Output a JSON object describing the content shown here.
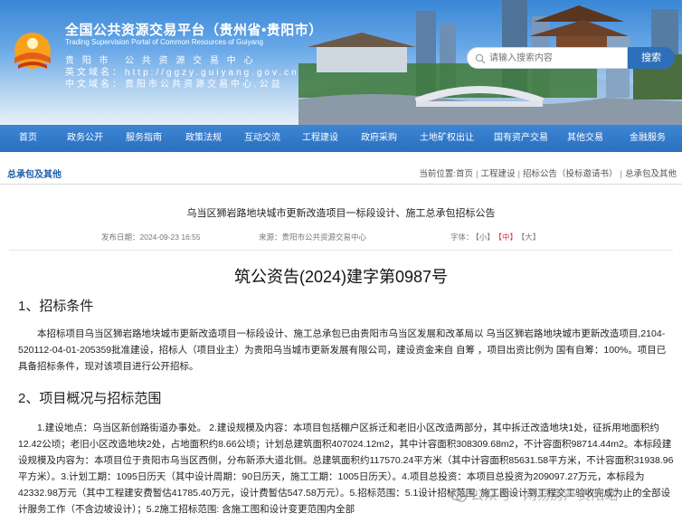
{
  "header": {
    "site_title": "全国公共资源交易平台（贵州省•贵阳市）",
    "site_subtitle": "Trading Supervision Portal of Common Resources of Guiyang",
    "row1_label": "贵 阳 市",
    "row1_value": "公 共 资 源 交 易 中 心",
    "row2_label": "英文域名：",
    "row2_value": "http://ggzy.guiyang.gov.cn",
    "row3_label": "中文域名：",
    "row3_value": "贵阳市公共资源交易中心.公益",
    "search_placeholder": "请输入搜索内容",
    "search_button": "搜索"
  },
  "nav": {
    "items": [
      "首页",
      "政务公开",
      "服务指南",
      "政策法规",
      "互动交流",
      "工程建设",
      "政府采购",
      "土地矿权出让",
      "国有资产交易",
      "其他交易",
      "金融服务"
    ]
  },
  "breadcrumb": {
    "section": "总承包及其他",
    "path": [
      "当前位置:首页",
      "工程建设",
      "招标公告（投标邀请书）",
      "总承包及其他"
    ]
  },
  "article": {
    "title": "乌当区狮岩路地块城市更新改造项目一标段设计、施工总承包招标公告",
    "publish_time": "发布日期：2024-09-23 16:55",
    "source": "来源：贵阳市公共资源交易中心",
    "font_label": "字体：",
    "font_small": "【小】",
    "font_medium": "【中】",
    "font_large": "【大】",
    "doc_number": "筑公资告(2024)建字第0987号",
    "section1_heading": "1、招标条件",
    "section1_text": "本招标项目乌当区狮岩路地块城市更新改造项目一标段设计、施工总承包已由贵阳市乌当区发展和改革局以 乌当区狮岩路地块城市更新改造项目,2104-520112-04-01-205359批准建设，招标人（项目业主）为贵阳乌当城市更新发展有限公司，建设资金来自 自筹 ，项目出资比例为 国有自筹：100%。项目已具备招标条件，现对该项目进行公开招标。",
    "section2_heading": "2、项目概况与招标范围",
    "section2_text": "1.建设地点：乌当区新创路街道办事处。 2.建设规模及内容：本项目包括棚户区拆迁和老旧小区改造两部分，其中拆迁改造地块1处，征拆用地面积约12.42公顷；老旧小区改造地块2处，占地面积约8.66公顷；计划总建筑面积407024.12m2，其中计容面积308309.68m2，不计容面积98714.44m2。本标段建设规模及内容为：本项目位于贵阳市乌当区西侧，分布新添大道北侧。总建筑面积约117570.24平方米（其中计容面积85631.58平方米，不计容面积31938.96平方米）。3.计划工期：1095日历天（其中设计周期：90日历天，施工工期：1005日历天）。4.项目总投资：本项目总投资为209097.27万元，本标段为42332.98万元（其中工程建安费暂估41785.40万元，设计费暂估547.58万元）。5.招标范围：5.1设计招标范围: 施工图设计到工程交工验收完成为止的全部设计服务工作（不含边坡设计）；5.2施工招标范围: 含施工图和设计变更范围内全部"
  },
  "watermark": "公众号 · 网易房产贵阳站",
  "colors": {
    "nav_bg": "#2a6fbf",
    "accent": "#1d5ea8",
    "font_active": "#d33"
  }
}
